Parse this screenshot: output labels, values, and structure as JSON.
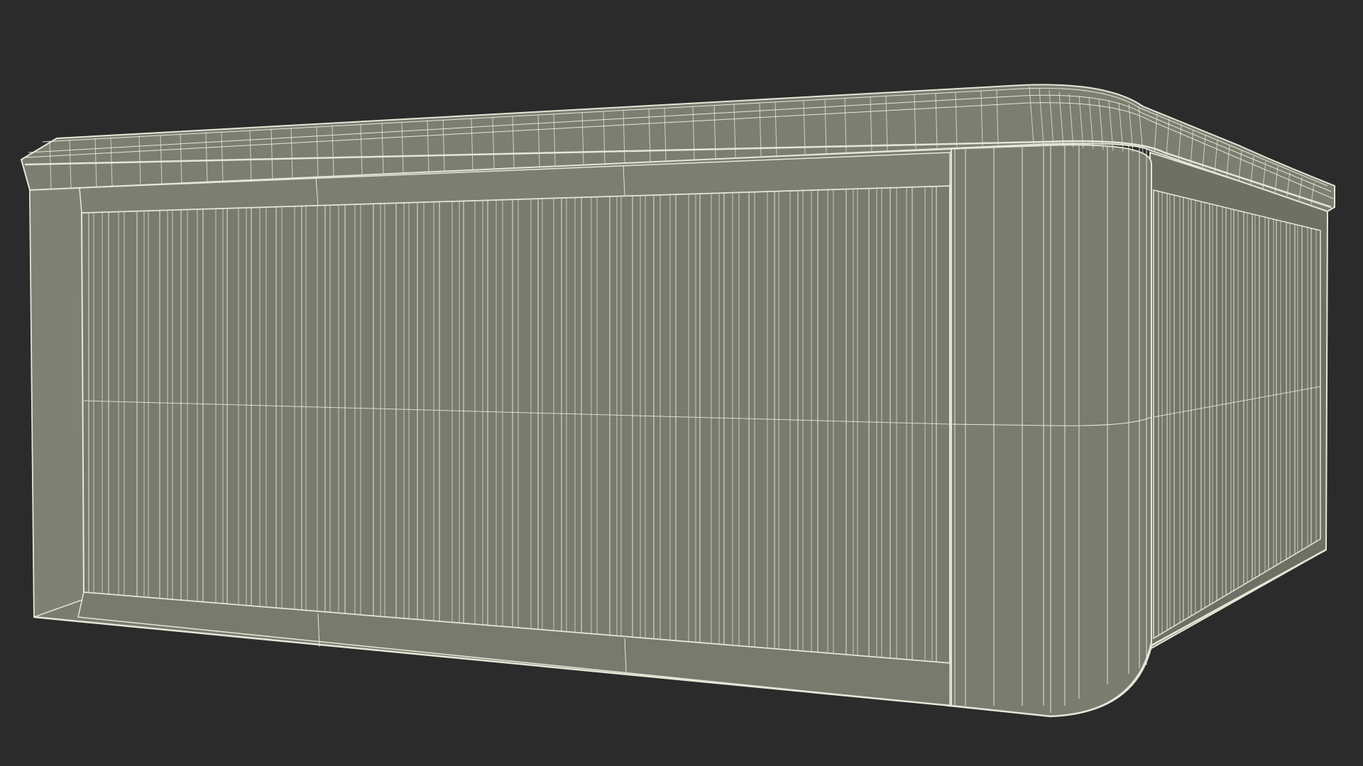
{
  "scene": {
    "background_color": "#2b2b2b",
    "subject": "hot-tub-wireframe-render",
    "colors": {
      "surface": "#7b7c70",
      "surface_dark": "#6f7065",
      "surface_light": "#8a8b7f",
      "wire": "#e6e6d8",
      "wire_soft": "#cfcfc2"
    }
  }
}
